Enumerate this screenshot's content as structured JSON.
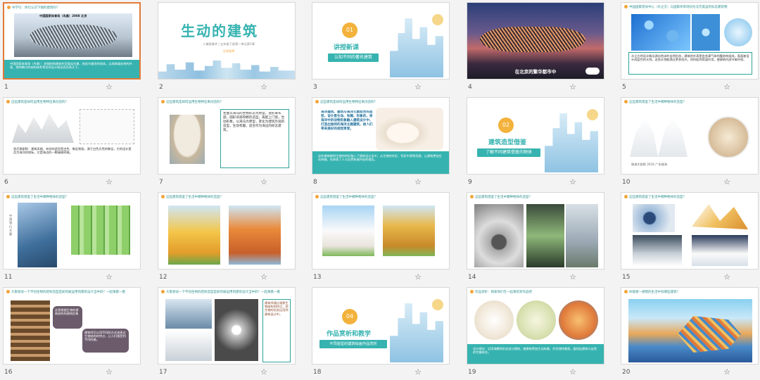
{
  "slides": [
    {
      "num": "1",
      "header": "导学引：你们认识下图的建筑吗？",
      "caption": "中国国家体育场（鸟巢）2008 北京",
      "body": "中国国家体育场（鸟巢）：其钢结构建筑外型类似鸟巢，宛若鸟巢形的母体，以其新颖宏伟的外观、独特精巧的结构体系等优秀设计理念而名扬天下。"
    },
    {
      "num": "2",
      "title": "生动的建筑",
      "sub1": "人美版美术 | 五年级下册第一单元第1课",
      "sub2": "主讲老师"
    },
    {
      "num": "3",
      "circle": "01",
      "title": "讲授新课",
      "pill": "认知不同的著名建筑"
    },
    {
      "num": "4",
      "caption": "在北京的繁华都市中"
    },
    {
      "num": "5",
      "header": "中国国家游泳中心（水立方）与国家体育场同为北京奥运的标志建筑物",
      "body": "水立方的设计概念源自泡沫的自然形态，建筑的外表是由充满气体的膜结构组成，表面被设计成蓝色的水泡。这些水泡能透过更多阳光，同时起到保温作用，使建筑内部节能环保。"
    },
    {
      "num": "6",
      "header": "这些建筑是如何运用生物特征来创造的？",
      "body": "悉尼歌剧院：建筑风格，有别的造型是白色、象征帆船，源于白色贝壳的象征，它的设计是否为海洋的地标，它是海边的一颗璀璨明珠。"
    },
    {
      "num": "7",
      "header": "这些建筑是如何运用生物特征来创造的？",
      "body": "左图以海马的生物形态为原型，变形来头部，圆形背部和鳍的造型，再配上门窗，生动形象。以海马为原型，变化为建筑外观的造型，生动有趣，适合作为海边的标志建筑。"
    },
    {
      "num": "8",
      "header": "这些建筑是如何运用生物特征来创造的？",
      "body": "海洋建筑、建筑与海洋元素结合的造型，设计是生动、有趣、形象的，将海洋中的动物形象融入建筑设计中，打造出独特的海洋主题建筑，给人们带来美好的视觉享受。",
      "body2": "这些建筑都把生物的特征融入了建筑设计当中，从生物的外形、色彩中获得灵感，让建筑更加生动有趣，也体现了人与自然和谐共处的理念。"
    },
    {
      "num": "9",
      "circle": "02",
      "title": "建筑造型借鉴",
      "pill": "了解不同建筑借鉴的物体"
    },
    {
      "num": "10",
      "header": "这些建筑借鉴了生活中哪种物体的造型？",
      "caption": "珠海大剧院 2016 广东珠海"
    },
    {
      "num": "11",
      "header": "这些建筑借鉴了生活中哪种物体的造型？",
      "side": "中国银行大厦"
    },
    {
      "num": "12",
      "header": "这些建筑借鉴了生活中哪种物体的造型？"
    },
    {
      "num": "13",
      "header": "这些建筑借鉴了生活中哪种物体的造型？"
    },
    {
      "num": "14",
      "header": "这些建筑借鉴了生活中哪种物体的造型？"
    },
    {
      "num": "15",
      "header": "这些建筑借鉴了生活中哪种物体的造型？"
    },
    {
      "num": "16",
      "header": "大家尝试一下不同生物的结构造型是如何被运用到建筑设计当中的？一起来看一看",
      "bubble1": "这是根据生物的建筑结构的建筑形象",
      "bubble2": "建筑师可以用不同的方式来表达生物结构的特点，让人们感受到不同的美。"
    },
    {
      "num": "17",
      "header": "大家尝试一下不同生物的结构造型是如何被运用到建筑设计当中的？一起来看一看",
      "body": "建筑师通过观察生物结构的特点，把生物的形态运用到建筑设计中。"
    },
    {
      "num": "18",
      "circle": "04",
      "title": "作品赏析和教学",
      "pill": "不同造型的建筑绘画作品赏析"
    },
    {
      "num": "19",
      "header": "作品赏析：探索你们在一起来欣赏作品吧",
      "body": "设计理念：运用海螺的形态设计建筑，使建筑更加生动有趣，外形独特美观，展现出建筑与自然的完美结合。"
    },
    {
      "num": "20",
      "header": "你能想一想我的生活中有哪些建筑？"
    }
  ],
  "ui": {
    "star_icon": "☆"
  },
  "colors": {
    "teal": "#36b3b0",
    "orange": "#f2b23b",
    "select": "#e07a3a"
  }
}
